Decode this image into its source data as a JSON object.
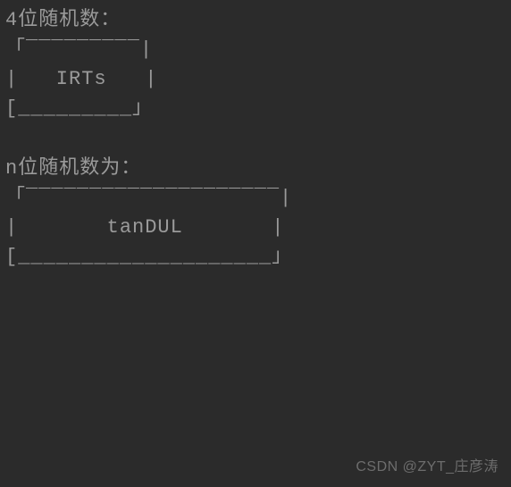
{
  "section1": {
    "title": "4位随机数：",
    "box_top": "「‾‾‾‾‾‾‾‾‾|",
    "box_middle": "|   IRTs   |",
    "box_bottom": "[_________」"
  },
  "section2": {
    "title": "n位随机数为：",
    "box_top": "「‾‾‾‾‾‾‾‾‾‾‾‾‾‾‾‾‾‾‾‾|",
    "box_middle": "|       tanDUL       |",
    "box_bottom": "[____________________」"
  },
  "watermark": "CSDN @ZYT_庄彦涛"
}
